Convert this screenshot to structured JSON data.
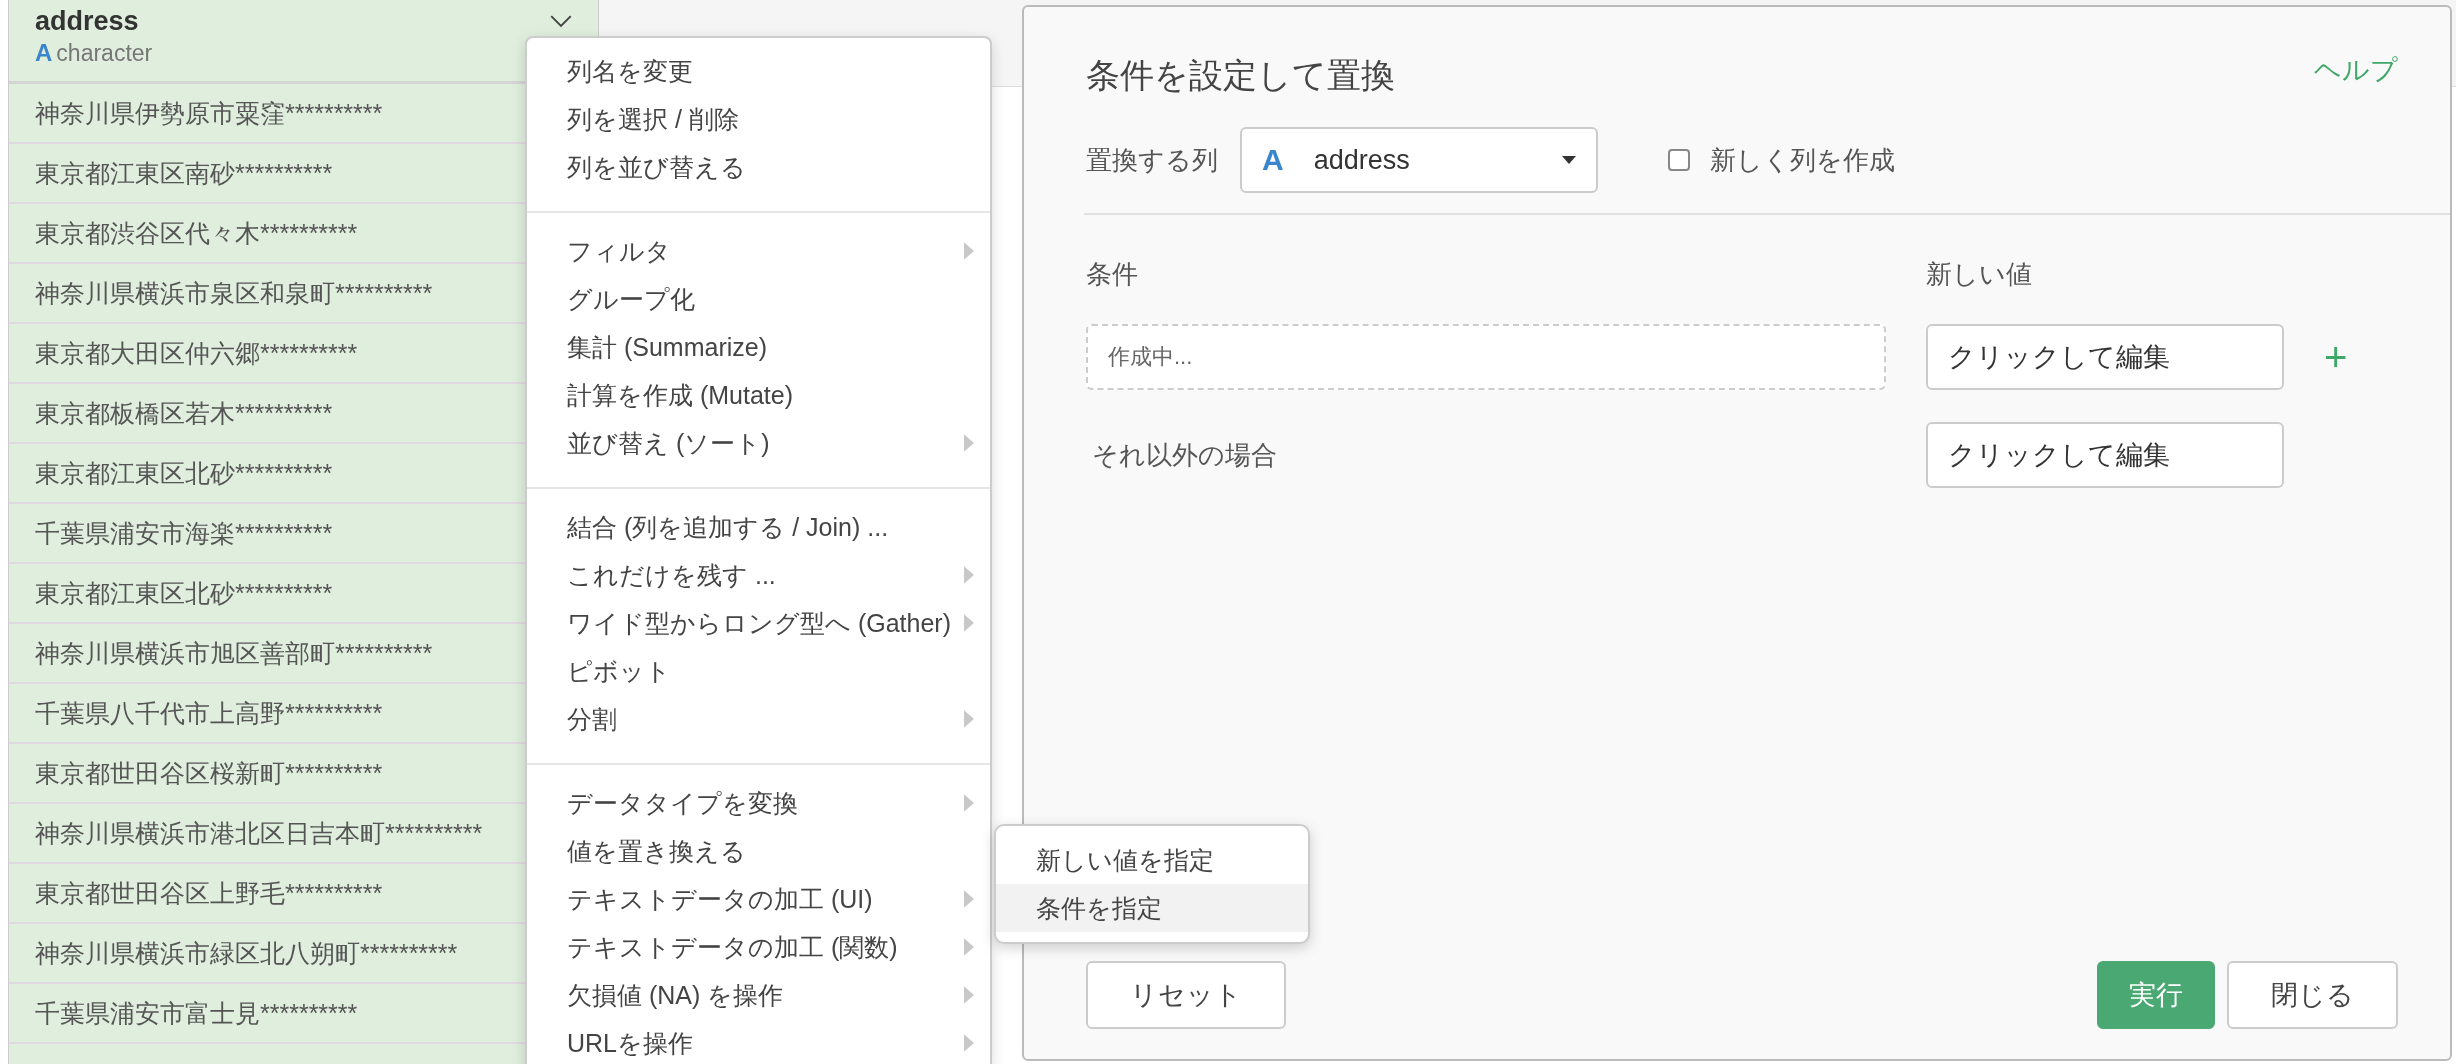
{
  "column": {
    "name": "address",
    "type_icon": "A",
    "type": "character",
    "cells": [
      "神奈川県伊勢原市粟窪**********",
      "東京都江東区南砂**********",
      "東京都渋谷区代々木**********",
      "神奈川県横浜市泉区和泉町**********",
      "東京都大田区仲六郷**********",
      "東京都板橋区若木**********",
      "東京都江東区北砂**********",
      "千葉県浦安市海楽**********",
      "東京都江東区北砂**********",
      "神奈川県横浜市旭区善部町**********",
      "千葉県八千代市上高野**********",
      "東京都世田谷区桜新町**********",
      "神奈川県横浜市港北区日吉本町**********",
      "東京都世田谷区上野毛**********",
      "神奈川県横浜市緑区北八朔町**********",
      "千葉県浦安市富士見**********"
    ]
  },
  "menu": {
    "sections": [
      [
        {
          "label": "列名を変更",
          "has_submenu": false
        },
        {
          "label": "列を選択 / 削除",
          "has_submenu": false
        },
        {
          "label": "列を並び替える",
          "has_submenu": false
        }
      ],
      [
        {
          "label": "フィルタ",
          "has_submenu": true
        },
        {
          "label": "グループ化",
          "has_submenu": false
        },
        {
          "label": "集計 (Summarize)",
          "has_submenu": false
        },
        {
          "label": "計算を作成 (Mutate)",
          "has_submenu": false
        },
        {
          "label": "並び替え (ソート)",
          "has_submenu": true
        }
      ],
      [
        {
          "label": "結合 (列を追加する / Join) ...",
          "has_submenu": false
        },
        {
          "label": "これだけを残す ...",
          "has_submenu": true
        },
        {
          "label": "ワイド型からロング型へ (Gather)",
          "has_submenu": true
        },
        {
          "label": "ピボット",
          "has_submenu": false
        },
        {
          "label": "分割",
          "has_submenu": true
        }
      ],
      [
        {
          "label": "データタイプを変換",
          "has_submenu": true
        },
        {
          "label": "値を置き換える",
          "has_submenu": false
        },
        {
          "label": "テキストデータの加工 (UI)",
          "has_submenu": true
        },
        {
          "label": "テキストデータの加工 (関数)",
          "has_submenu": true
        },
        {
          "label": "欠損値 (NA) を操作",
          "has_submenu": true
        },
        {
          "label": "URLを操作",
          "has_submenu": true
        }
      ]
    ]
  },
  "submenu": {
    "items": [
      {
        "label": "新しい値を指定",
        "selected": false
      },
      {
        "label": "条件を指定",
        "selected": true
      }
    ]
  },
  "dialog": {
    "title": "条件を設定して置換",
    "help": "ヘルプ",
    "column_label": "置換する列",
    "column_select": {
      "type_icon": "A",
      "value": "address"
    },
    "new_column": {
      "label": "新しく列を作成",
      "checked": false
    },
    "condition_header": "条件",
    "value_header": "新しい値",
    "rules": [
      {
        "condition_placeholder": "作成中...",
        "value": "クリックして編集"
      }
    ],
    "add": "+",
    "else_label": "それ以外の場合",
    "else_value": "クリックして編集",
    "reset": "リセット",
    "run": "実行",
    "close": "閉じる"
  }
}
